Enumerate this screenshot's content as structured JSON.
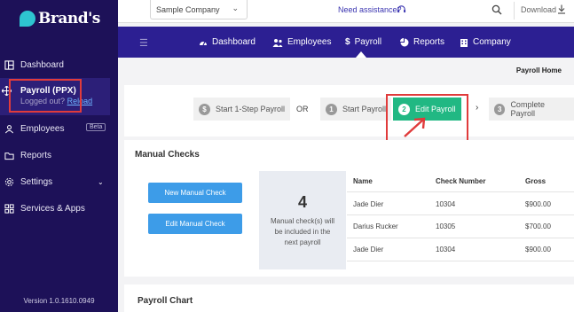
{
  "brand": {
    "name": "Brand's"
  },
  "sidebar": {
    "items": [
      {
        "label": "Dashboard",
        "icon": "dashboard-icon"
      },
      {
        "label": "Payroll (PPX)",
        "icon": "move-icon"
      },
      {
        "label": "Employees",
        "icon": "people-icon",
        "badge": "Beta"
      },
      {
        "label": "Reports",
        "icon": "folder-icon"
      },
      {
        "label": "Settings",
        "icon": "gear-icon"
      },
      {
        "label": "Services & Apps",
        "icon": "apps-icon"
      }
    ],
    "logged_out": "Logged out?",
    "reload": "Reload",
    "version": "Version 1.0.1610.0949"
  },
  "topbar": {
    "company": "Sample Company",
    "assistance": "Need assistance?",
    "download": "Download"
  },
  "navbar": {
    "tabs": [
      {
        "label": "Dashboard",
        "icon": "gauge-icon"
      },
      {
        "label": "Employees",
        "icon": "people-icon"
      },
      {
        "label": "Payroll",
        "icon": "dollar-icon"
      },
      {
        "label": "Reports",
        "icon": "pie-chart-icon"
      },
      {
        "label": "Company",
        "icon": "building-icon"
      }
    ]
  },
  "breadcrumb": "Payroll Home",
  "steps": {
    "start_one": "Start 1-Step Payroll",
    "or": "OR",
    "start": {
      "num": "1",
      "label": "Start Payroll"
    },
    "edit": {
      "num": "2",
      "label": "Edit Payroll"
    },
    "complete": {
      "num": "3",
      "label": "Complete Payroll"
    }
  },
  "manual_checks": {
    "title": "Manual Checks",
    "new_button": "New Manual Check",
    "edit_button": "Edit Manual Check",
    "count": "4",
    "count_text": "Manual check(s) will be included in the next payroll",
    "columns": [
      "Name",
      "Check Number",
      "Gross"
    ],
    "rows": [
      [
        "Jade Dier",
        "10304",
        "$900.00"
      ],
      [
        "Darius Rucker",
        "10305",
        "$700.00"
      ],
      [
        "Jade Dier",
        "10304",
        "$900.00"
      ]
    ]
  },
  "payroll_chart": {
    "title": "Payroll Chart"
  },
  "colors": {
    "sidebar": "#1d1158",
    "navbar": "#2c1f92",
    "accent_green": "#21b883",
    "button_blue": "#3d9ce8",
    "highlight_red": "#e03b3b"
  }
}
